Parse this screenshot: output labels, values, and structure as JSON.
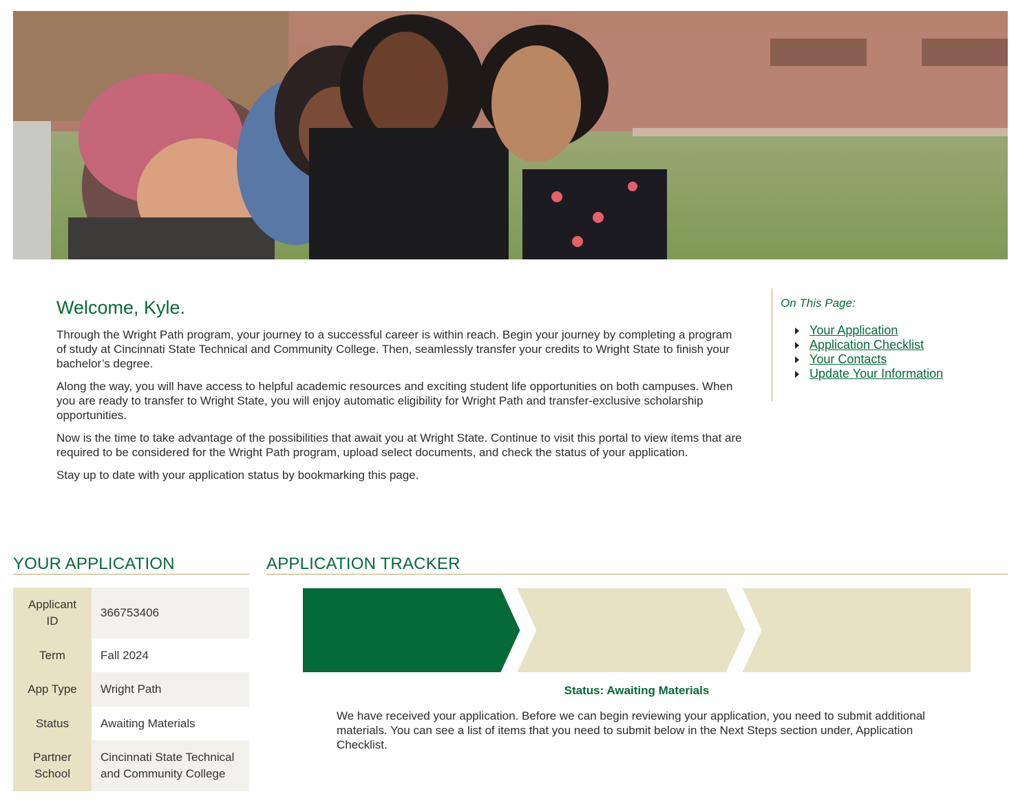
{
  "hero": {
    "alt": "students-hugging-photo"
  },
  "welcome": {
    "title": "Welcome, Kyle.",
    "paragraphs": [
      "Through the Wright Path program, your journey to a successful career is within reach. Begin your journey by completing a program of study at Cincinnati State Technical and Community College. Then, seamlessly transfer your credits to Wright State to finish your bachelor’s degree.",
      "Along the way, you will have access to helpful academic resources and exciting student life opportunities on both campuses. When you are ready to transfer to Wright State, you will enjoy automatic eligibility for Wright Path and transfer-exclusive scholarship opportunities.",
      "Now is the time to take advantage of the possibilities that await you at Wright State. Continue to visit this portal to view items that are required to be considered for the Wright Path program, upload select documents, and check the status of your application.",
      "Stay up to date with your application status by bookmarking this page."
    ]
  },
  "on_this_page": {
    "heading": "On This Page:",
    "links": [
      "Your Application",
      "Application Checklist",
      "Your Contacts",
      "Update Your Information"
    ]
  },
  "your_application": {
    "heading": "YOUR APPLICATION",
    "rows": [
      {
        "label": "Applicant ID",
        "value": "366753406"
      },
      {
        "label": "Term",
        "value": "Fall 2024"
      },
      {
        "label": "App Type",
        "value": "Wright Path"
      },
      {
        "label": "Status",
        "value": "Awaiting Materials"
      },
      {
        "label": "Partner School",
        "value": "Cincinnati State Technical and Community College"
      }
    ]
  },
  "tracker": {
    "heading": "APPLICATION TRACKER",
    "steps_total": 3,
    "steps_complete": 1,
    "status": "Status: Awaiting Materials",
    "description": "We have received your application. Before we can begin reviewing your application, you need to submit additional materials. You can see a list of items that you need to submit below in the Next Steps section under, Application Checklist."
  },
  "colors": {
    "brand_green": "#046a38",
    "step_inactive": "#e7e2c4",
    "gold_rule": "#b9a56a"
  }
}
